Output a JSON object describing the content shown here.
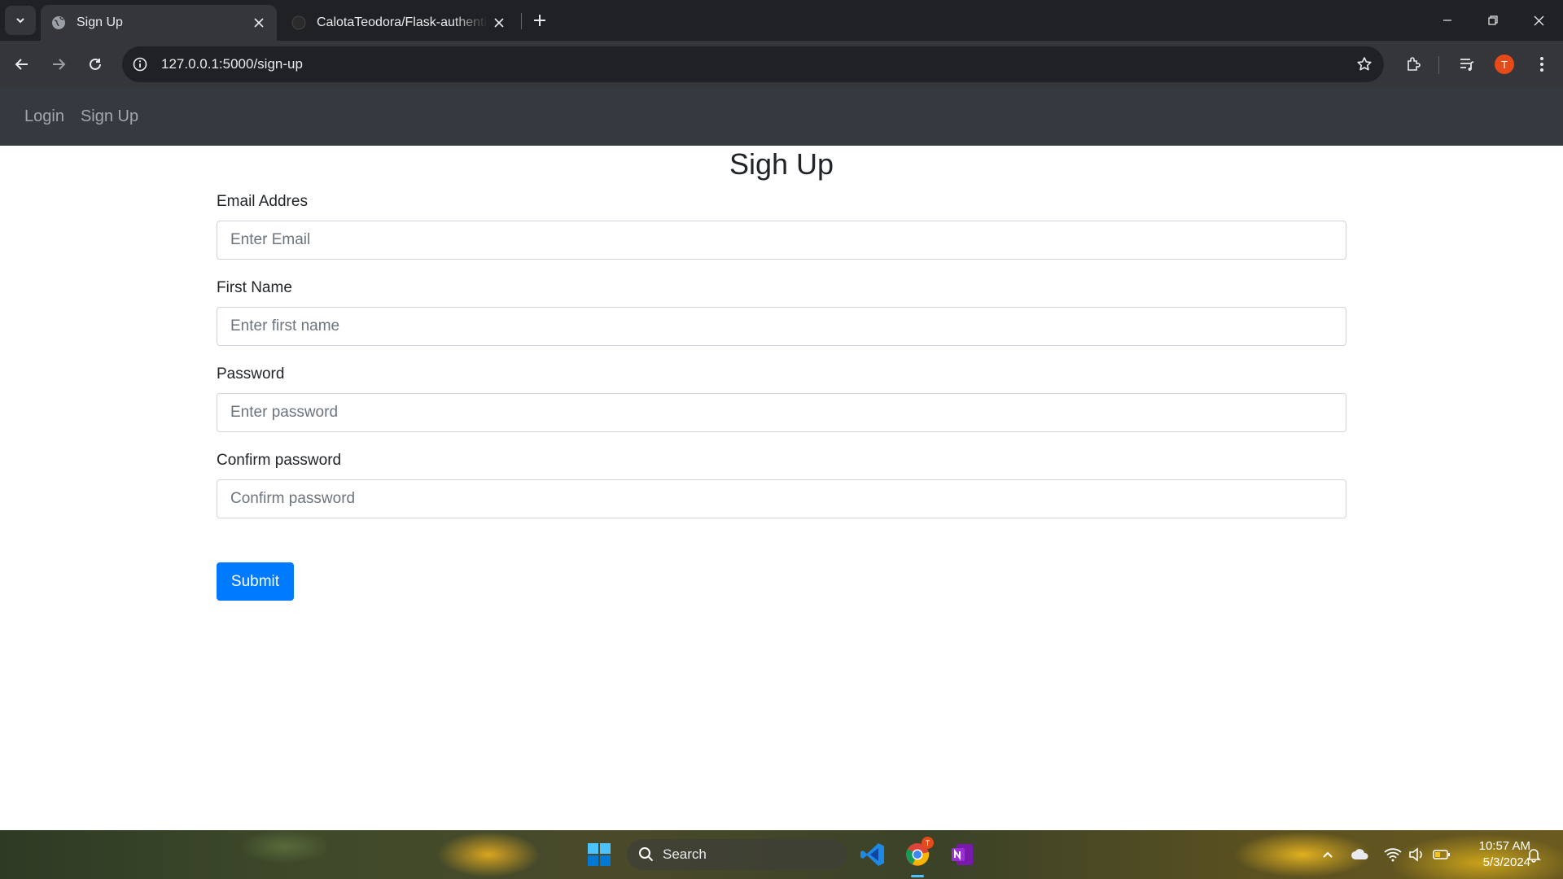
{
  "browser": {
    "tabs": [
      {
        "title": "Sign Up",
        "active": true
      },
      {
        "title": "CalotaTeodora/Flask-authentication",
        "active": false
      }
    ],
    "url": "127.0.0.1:5000/sign-up",
    "profile_initial": "T"
  },
  "navbar": {
    "links": [
      "Login",
      "Sign Up"
    ]
  },
  "form": {
    "heading": "Sigh Up",
    "fields": [
      {
        "label": "Email Addres",
        "placeholder": "Enter Email"
      },
      {
        "label": "First Name",
        "placeholder": "Enter first name"
      },
      {
        "label": "Password",
        "placeholder": "Enter password"
      },
      {
        "label": "Confirm password",
        "placeholder": "Confirm password"
      }
    ],
    "submit_label": "Submit",
    "button_color": "#007bff"
  },
  "taskbar": {
    "search_label": "Search",
    "time": "10:57 AM",
    "date": "5/3/2024",
    "chrome_badge": "T"
  }
}
